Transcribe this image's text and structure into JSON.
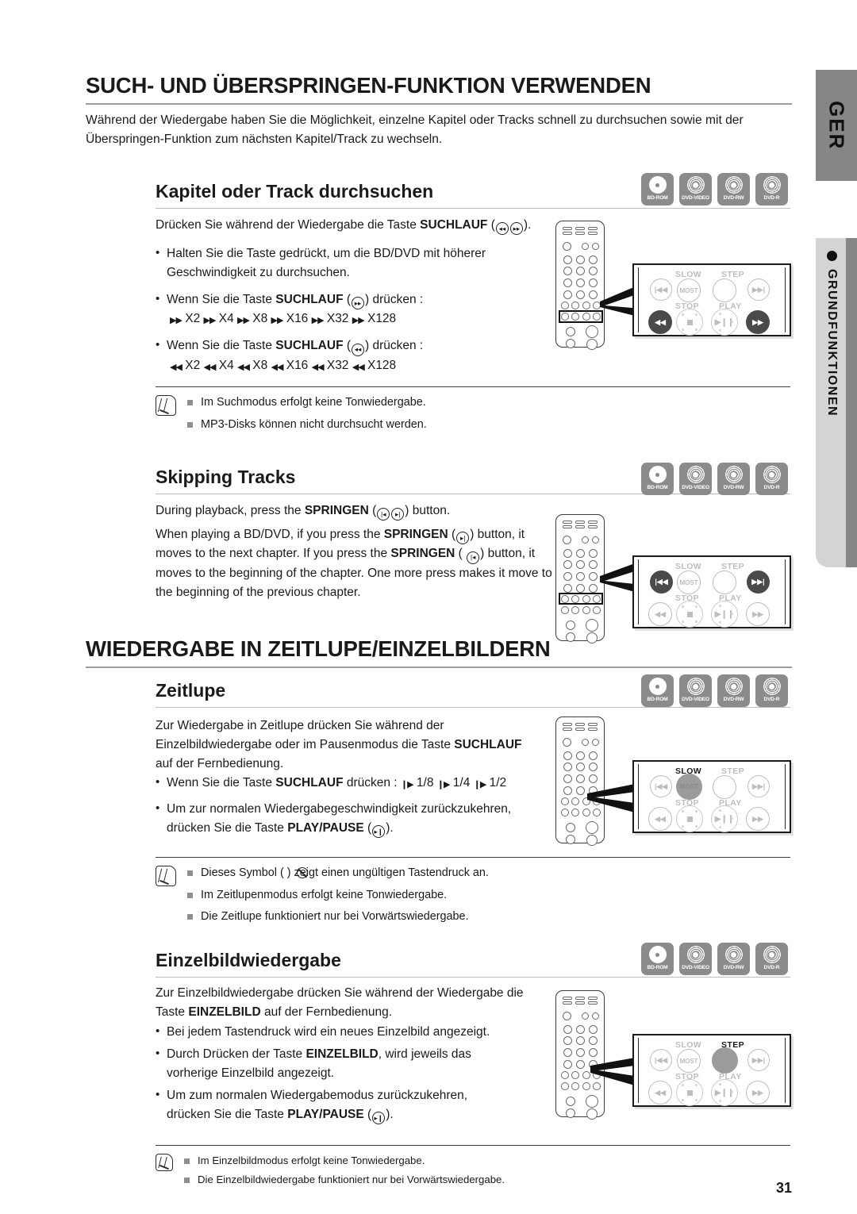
{
  "sidebar": {
    "language_tab": "GER",
    "chapter_tab": "GRUNDFUNKTIONEN",
    "bullet_icon": "filled-circle"
  },
  "page_number": "31",
  "sections": [
    {
      "id": "search-skip",
      "heading": "SUCH- UND ÜBERSPRINGEN-FUNKTION VERWENDEN",
      "intro": "Während der Wiedergabe haben Sie die Möglichkeit, einzelne Kapitel oder Tracks schnell zu durchsuchen sowie mit der Überspringen-Funktion zum nächsten Kapitel/Track zu wechseln."
    },
    {
      "id": "slow-step",
      "heading": "WIEDERGABE IN ZEITLUPE/EINZELBILDERN"
    }
  ],
  "sub1": {
    "heading": "Kapitel oder Track durchsuchen",
    "lead_a": "Drücken Sie während der Wiedergabe die Taste ",
    "lead_bold": "SUCHLAUF",
    "lead_b": " (",
    "lead_c": ").",
    "bullets": [
      {
        "line1": "Halten Sie die Taste gedrückt, um die BD/DVD mit höherer",
        "line2": "Geschwindigkeit zu durchsuchen."
      },
      {
        "pre": "Wenn Sie die Taste ",
        "bold": "SUCHLAUF",
        "post": ") drücken :",
        "speeds": "X2  X4  X8  X16  X32  X128",
        "dir": "forward"
      },
      {
        "pre": "Wenn Sie die Taste ",
        "bold": "SUCHLAUF",
        "post": ") drücken :",
        "speeds": "X2  X4  X8  X16  X32  X128",
        "dir": "reverse"
      }
    ],
    "notes": [
      "Im Suchmodus erfolgt keine Tonwiedergabe.",
      "MP3-Disks können nicht durchsucht werden."
    ]
  },
  "sub2": {
    "heading": "Skipping Tracks",
    "p1_a": "During playback, press the ",
    "p1_bold": "SPRINGEN",
    "p1_b": " (",
    "p1_c": ") button.",
    "p2_a": "When playing a BD/DVD, if you press the ",
    "p2_bold1": "SPRINGEN",
    "p2_b": ") button, it moves to the next chapter. If you press the ",
    "p2_bold2": "SPRINGEN",
    "p2_c": ") button, it moves to the beginning of the chapter. One more press makes it move to the beginning of the previous chapter."
  },
  "sub3": {
    "heading": "Zeitlupe",
    "p1_a": "Zur Wiedergabe in Zeitlupe drücken Sie während der Einzelbildwiedergabe oder im Pausenmodus die Taste ",
    "p1_bold": "SUCHLAUF",
    "p1_b": " auf der Fernbedienung.",
    "bullets": [
      {
        "pre": "Wenn Sie die Taste ",
        "bold": "SUCHLAUF",
        "post": " drücken : ",
        "speeds": "1/8  1/4  1/2"
      },
      {
        "line1": "Um zur normalen Wiedergabegeschwindigkeit zurückzukehren,",
        "line2_pre": "drücken Sie die Taste ",
        "line2_bold": "PLAY/PAUSE",
        "line2_post": ")."
      }
    ],
    "notes": [
      "Dieses Symbol (  ) zeigt einen ungültigen Tastendruck an.",
      "Im Zeitlupenmodus erfolgt keine Tonwiedergabe.",
      "Die Zeitlupe funktioniert nur bei Vorwärtswiedergabe."
    ]
  },
  "sub4": {
    "heading": "Einzelbildwiedergabe",
    "p1_a": "Zur Einzelbildwiedergabe drücken Sie während der Wiedergabe die Taste ",
    "p1_bold": "EINZELBILD",
    "p1_b": " auf der Fernbedienung.",
    "bullets": [
      {
        "text": "Bei jedem Tastendruck wird ein neues Einzelbild angezeigt."
      },
      {
        "pre": "Durch Drücken der Taste ",
        "bold": "EINZELBILD",
        "post": ", wird jeweils das",
        "line2": "vorherige Einzelbild angezeigt."
      },
      {
        "line1": "Um zum normalen Wiedergabemodus zurückzukehren,",
        "line2_pre": "drücken Sie die Taste ",
        "line2_bold": "PLAY/PAUSE",
        "line2_post": ")."
      }
    ],
    "notes": [
      "Im Einzelbildmodus erfolgt keine Tonwiedergabe.",
      "Die Einzelbildwiedergabe funktioniert nur bei Vorwärtswiedergabe."
    ]
  },
  "disc_icons": [
    {
      "label": "BD-ROM",
      "style": "solid"
    },
    {
      "label": "DVD-VIDEO",
      "style": "rings"
    },
    {
      "label": "DVD-RW",
      "style": "rings"
    },
    {
      "label": "DVD-R",
      "style": "rings"
    }
  ],
  "callouts": {
    "labels": {
      "slow": "SLOW",
      "step": "STEP",
      "stop": "STOP",
      "play": "PLAY",
      "most": "MOST"
    },
    "panels": [
      {
        "id": "panel-search",
        "highlight": [
          "rew",
          "ff"
        ]
      },
      {
        "id": "panel-skip",
        "highlight": [
          "prev",
          "next"
        ]
      },
      {
        "id": "panel-slow",
        "highlight": [
          "most"
        ]
      },
      {
        "id": "panel-step",
        "highlight": [
          "step"
        ]
      }
    ]
  },
  "colors": {
    "tab_dark": "#868686",
    "tab_light": "#d4d4d4",
    "disc_bg": "#8b8b8b",
    "btn_dark": "#4a4a4a",
    "btn_grey": "#9b9b9b",
    "rule": "#9c9c9c"
  }
}
